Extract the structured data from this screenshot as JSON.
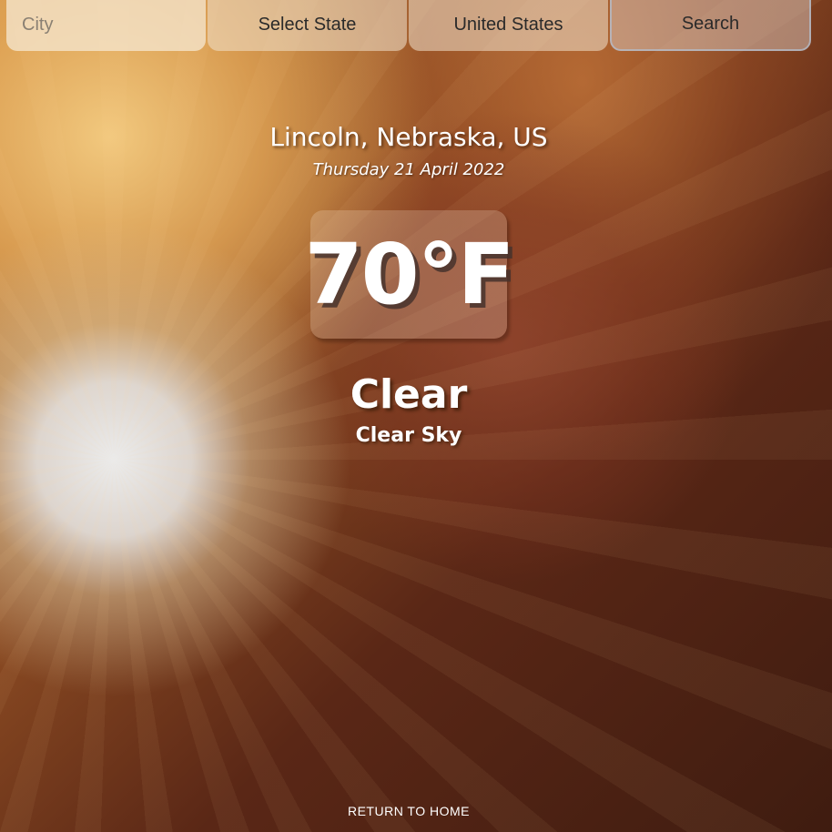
{
  "search_bar": {
    "city_placeholder": "City",
    "city_value": "",
    "state_selected": "Select State",
    "country_selected": "United States",
    "search_label": "Search"
  },
  "weather": {
    "location": "Lincoln, Nebraska, US",
    "date": "Thursday 21 April 2022",
    "temperature": "70°F",
    "condition": "Clear",
    "description": "Clear Sky"
  },
  "footer": {
    "return_label": "RETURN TO HOME"
  },
  "colors": {
    "text": "#ffffff",
    "field_text": "#2a2a2a"
  }
}
